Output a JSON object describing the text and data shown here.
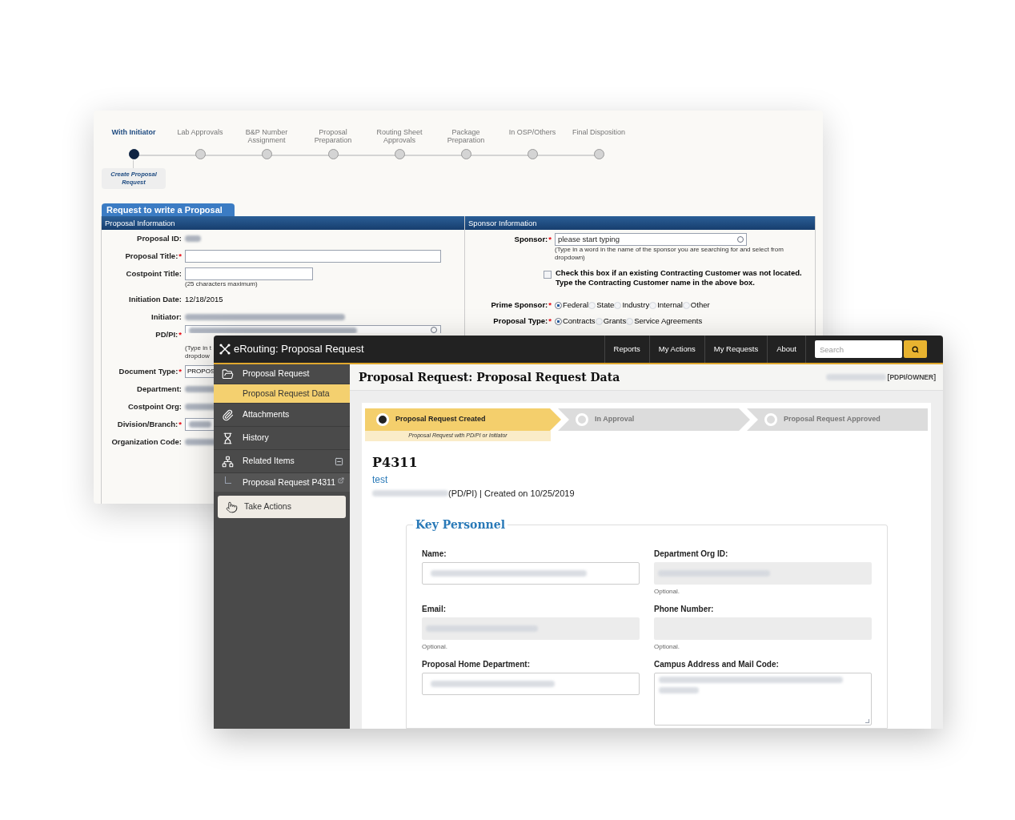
{
  "back_window": {
    "stages": [
      {
        "label": "With Initiator",
        "selected": true
      },
      {
        "label": "Lab Approvals",
        "selected": false
      },
      {
        "label": "B&P Number Assignment",
        "selected": false
      },
      {
        "label": "Proposal Preparation",
        "selected": false
      },
      {
        "label": "Routing Sheet Approvals",
        "selected": false
      },
      {
        "label": "Package Preparation",
        "selected": false
      },
      {
        "label": "In OSP/Others",
        "selected": false
      },
      {
        "label": "Final Disposition",
        "selected": false
      }
    ],
    "stage_note": "Create Proposal Request",
    "form_title": "Request to write a Proposal",
    "proposal_information": {
      "title": "Proposal Information",
      "fields": [
        {
          "label": "Proposal ID:",
          "kind": "redacted"
        },
        {
          "label": "Proposal Title:",
          "required_mark": "*",
          "kind": "input"
        },
        {
          "label": "Costpoint Title:",
          "kind": "input",
          "hint": [
            "(25 characters maximum)"
          ]
        },
        {
          "label": "Initiation Date:",
          "kind": "static",
          "value": "12/18/2015"
        },
        {
          "label": "Initiator:",
          "kind": "redacted"
        },
        {
          "label": "PD/PI:",
          "required_mark": "*",
          "kind": "lookup",
          "hint": [
            "(Type in t",
            "dropdow"
          ]
        },
        {
          "label": "Document Type:",
          "required_mark": "*",
          "kind": "input",
          "value": "PROPOS"
        },
        {
          "label": "Department:",
          "kind": "redacted"
        },
        {
          "label": "Costpoint Org:",
          "kind": "redacted"
        },
        {
          "label": "Division/Branch:",
          "required_mark": "*",
          "kind": "input_redacted"
        },
        {
          "label": "Organization Code:",
          "kind": "redacted"
        }
      ]
    },
    "sponsor_information": {
      "title": "Sponsor Information",
      "sponsor": {
        "label": "Sponsor:",
        "required_mark": "*",
        "placeholder": "please start typing",
        "hint": "(Type in a word in the name of the sponsor you are searching for and select from dropdown)"
      },
      "not_located": {
        "checked": false,
        "label": [
          "Check this box if an existing Contracting Customer was not located.",
          "Type the Contracting Customer name in the above box."
        ]
      },
      "radio_groups": [
        {
          "label": "Prime Sponsor:",
          "required_mark": "*",
          "options": [
            {
              "label": "Federal",
              "selected": true
            },
            {
              "label": "State",
              "selected": false
            },
            {
              "label": "Industry",
              "selected": false
            },
            {
              "label": "Internal",
              "selected": false
            },
            {
              "label": "Other",
              "selected": false
            }
          ]
        },
        {
          "label": "Proposal Type:",
          "required_mark": "*",
          "options": [
            {
              "label": "Contracts",
              "selected": true
            },
            {
              "label": "Grants",
              "selected": false
            },
            {
              "label": "Service Agreements",
              "selected": false
            }
          ]
        }
      ]
    }
  },
  "front_window": {
    "title": "eRouting: Proposal Request",
    "nav": [
      "Reports",
      "My Actions",
      "My Requests",
      "About"
    ],
    "search": {
      "placeholder": "Search"
    },
    "sidebar": [
      {
        "label": "Proposal Request",
        "kind": "section",
        "selected": false
      },
      {
        "label": "Proposal Request Data",
        "kind": "page",
        "selected": true
      },
      {
        "label": "Attachments",
        "kind": "section",
        "selected": false
      },
      {
        "label": "History",
        "kind": "section",
        "selected": false
      },
      {
        "label": "Related Items",
        "kind": "group",
        "selected": false,
        "expanded": true,
        "children": [
          {
            "label": "Proposal Request P4311",
            "selected": false
          }
        ]
      }
    ],
    "take_actions": "Take Actions",
    "page_title": "Proposal Request: Proposal Request Data",
    "user_role": "[PDPI/OWNER]",
    "steps": [
      {
        "label": "Proposal Request Created",
        "selected": true,
        "note": "Proposal Request with PD/PI or Initiator"
      },
      {
        "label": "In Approval",
        "selected": false
      },
      {
        "label": "Proposal Request Approved",
        "selected": false
      }
    ],
    "record": {
      "id": "P4311",
      "title": "test",
      "meta": "(PD/PI) | Created on 10/25/2019"
    },
    "key_personnel": {
      "title": "Key Personnel",
      "fields": [
        {
          "label": "Name:",
          "kind": "input"
        },
        {
          "label": "Department Org ID:",
          "kind": "readonly",
          "help": "Optional."
        },
        {
          "label": "Email:",
          "kind": "readonly",
          "help": "Optional."
        },
        {
          "label": "Phone Number:",
          "kind": "readonly_empty",
          "help": "Optional."
        },
        {
          "label": "Proposal Home Department:",
          "kind": "input"
        },
        {
          "label": "Campus Address and Mail Code:",
          "kind": "textarea"
        }
      ]
    }
  }
}
